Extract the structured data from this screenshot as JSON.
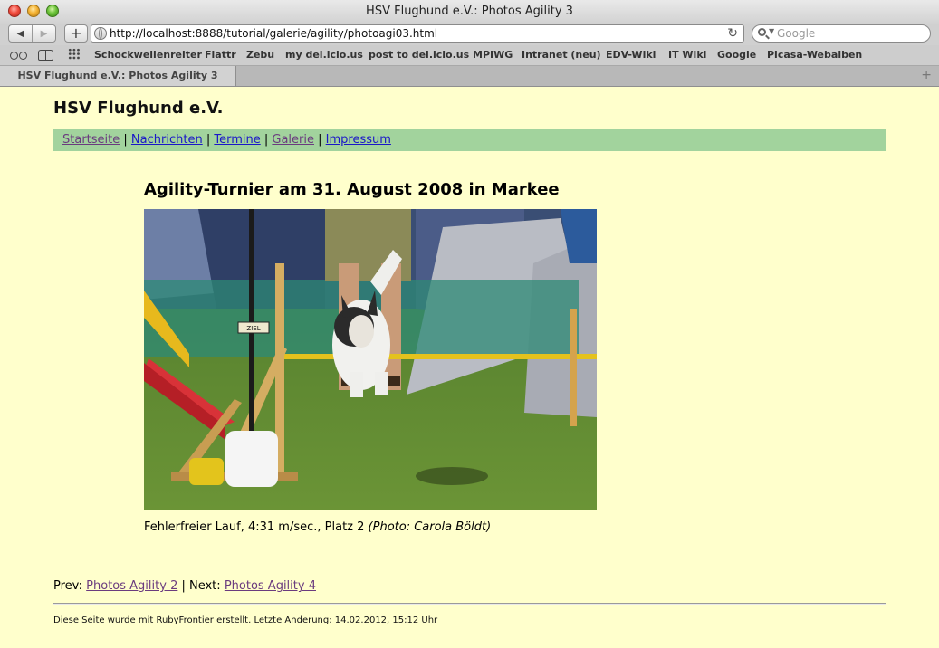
{
  "window": {
    "title": "HSV Flughund e.V.: Photos Agility 3"
  },
  "toolbar": {
    "back_label": "◀",
    "forward_label": "▶",
    "add_label": "+",
    "url": "http://localhost:8888/tutorial/galerie/agility/photoagi03.html",
    "reload_label": "↻",
    "search_placeholder": "Google"
  },
  "bookmarks": [
    "Schockwellenreiter",
    "Flattr",
    "Zebu",
    "my del.icio.us",
    "post to del.icio.us",
    "MPIWG",
    "Intranet (neu)",
    "EDV-Wiki",
    "IT Wiki",
    "Google",
    "Picasa-Webalben"
  ],
  "tab": {
    "label": "HSV Flughund e.V.: Photos Agility 3",
    "new_tab_label": "+"
  },
  "site": {
    "title": "HSV Flughund e.V.",
    "nav": [
      "Startseite",
      "Nachrichten",
      "Termine",
      "Galerie",
      "Impressum"
    ],
    "nav_separator": "|"
  },
  "article": {
    "title": "Agility-Turnier am 31. August 2008 in Markee",
    "photo_sign": "ZIEL",
    "caption": "Fehlerfreier Lauf, 4:31 m/sec., Platz 2",
    "caption_credit": "(Photo: Carola Böldt)"
  },
  "pager": {
    "prev_label": "Prev:",
    "prev_link": "Photos Agility 2",
    "separator": "| Next:",
    "next_link": "Photos Agility 4"
  },
  "footer": "Diese Seite wurde mit RubyFrontier erstellt. Letzte Änderung: 14.02.2012, 15:12 Uhr",
  "colors": {
    "page_background": "#ffffcc",
    "nav_background": "#a2d39d",
    "link": "#1a16c8",
    "visited_link": "#6a3b7e"
  }
}
